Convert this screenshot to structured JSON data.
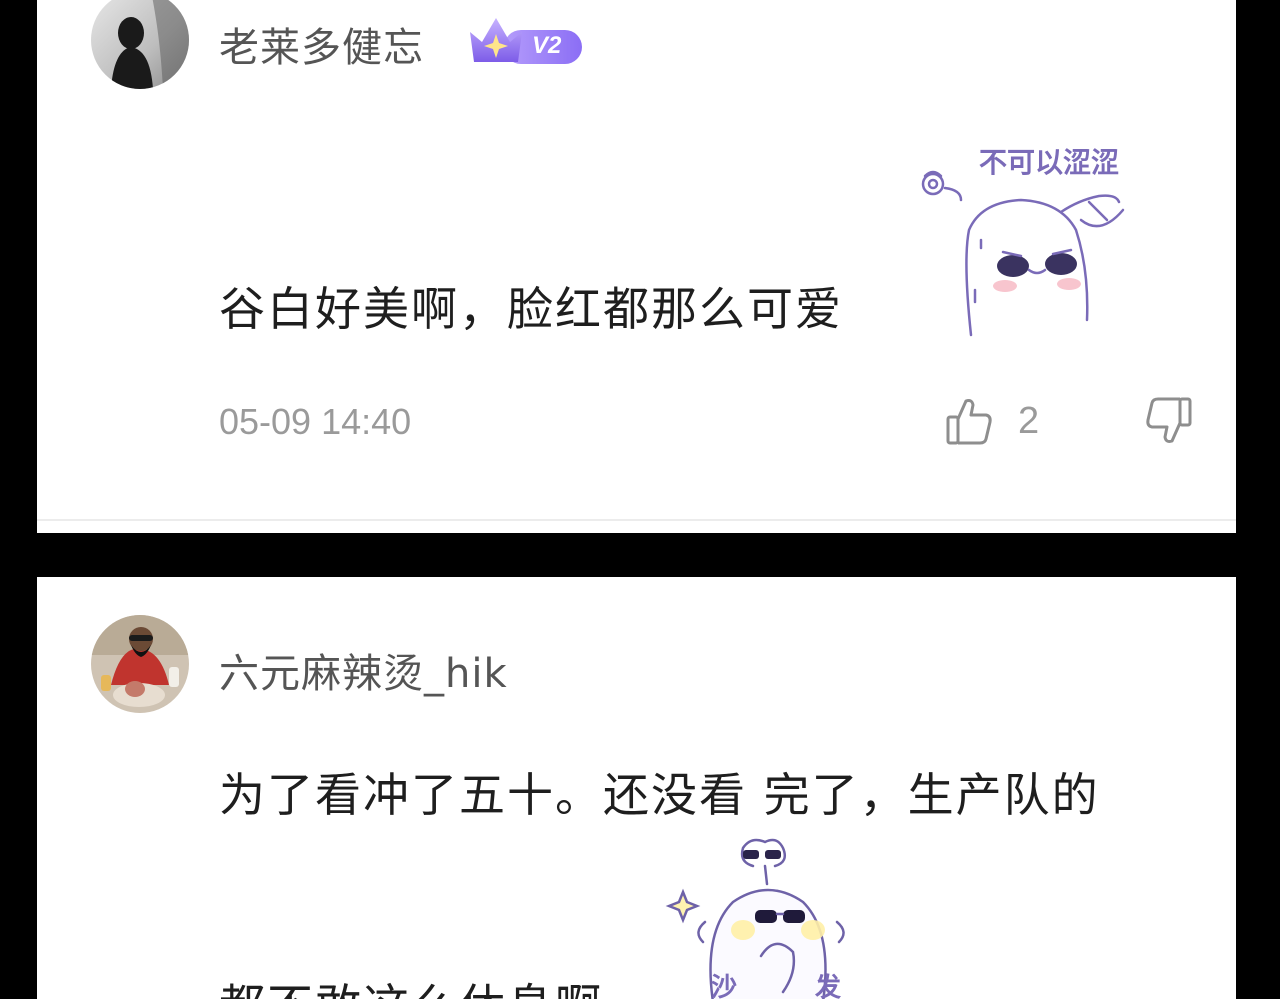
{
  "comments": [
    {
      "username": "老莱多健忘",
      "badge": {
        "level": "V2",
        "colors": [
          "#a98cf8",
          "#7b5cf2"
        ]
      },
      "text": "谷白好美啊，脸红都那么可爱",
      "sticker": {
        "name": "shy-potato-sticker",
        "caption": "不可以涩涩"
      },
      "timestamp": "05-09 14:40",
      "likes": "2"
    },
    {
      "username": "六元麻辣烫_hik",
      "text_line1": "为了看冲了五十。还没看 完了，生产队的",
      "text_line2": "都不敢这么休息啊",
      "sticker": {
        "name": "sunglasses-potato-sticker",
        "caption": "沙发"
      }
    }
  ],
  "colors": {
    "background": "#000000",
    "card": "#ffffff",
    "username": "#555555",
    "text": "#1e1e1e",
    "meta": "#9a9a9a",
    "sticker_line": "#7a6bb8"
  }
}
